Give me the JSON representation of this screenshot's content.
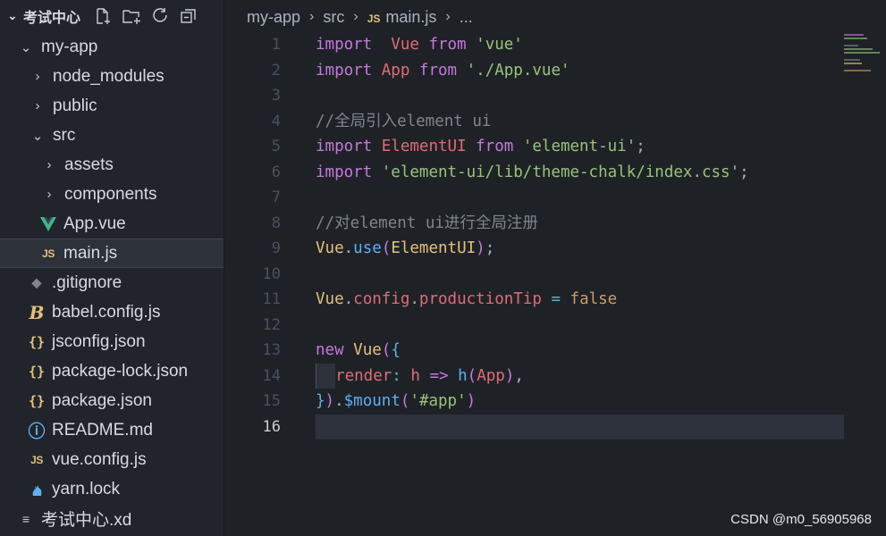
{
  "sidebar": {
    "title": "考试中心",
    "actions": [
      "new-file-icon",
      "new-folder-icon",
      "refresh-icon",
      "collapse-all-icon"
    ],
    "items": [
      {
        "label": "my-app",
        "twist": "⌄",
        "icon": ""
      },
      {
        "label": "node_modules",
        "twist": "›",
        "icon": ""
      },
      {
        "label": "public",
        "twist": "›",
        "icon": ""
      },
      {
        "label": "src",
        "twist": "⌄",
        "icon": ""
      },
      {
        "label": "assets",
        "twist": "›",
        "icon": ""
      },
      {
        "label": "components",
        "twist": "›",
        "icon": ""
      },
      {
        "label": "App.vue",
        "twist": "",
        "icon": "V"
      },
      {
        "label": "main.js",
        "twist": "",
        "icon": "JS"
      },
      {
        "label": ".gitignore",
        "twist": "",
        "icon": "◆"
      },
      {
        "label": "babel.config.js",
        "twist": "",
        "icon": "B"
      },
      {
        "label": "jsconfig.json",
        "twist": "",
        "icon": "{}"
      },
      {
        "label": "package-lock.json",
        "twist": "",
        "icon": "{}"
      },
      {
        "label": "package.json",
        "twist": "",
        "icon": "{}"
      },
      {
        "label": "README.md",
        "twist": "",
        "icon": "ⓘ"
      },
      {
        "label": "vue.config.js",
        "twist": "",
        "icon": "JS"
      },
      {
        "label": "yarn.lock",
        "twist": "",
        "icon": "🐈"
      },
      {
        "label": "考试中心.xd",
        "twist": "",
        "icon": "≡"
      }
    ]
  },
  "breadcrumb": {
    "items": [
      "my-app",
      "src",
      "main.js",
      "..."
    ],
    "file_icon": "JS"
  },
  "editor": {
    "line_numbers": [
      "1",
      "2",
      "3",
      "4",
      "5",
      "6",
      "7",
      "8",
      "9",
      "10",
      "11",
      "12",
      "13",
      "14",
      "15",
      "16"
    ],
    "active_line": "16"
  },
  "watermark": "CSDN @m0_56905968"
}
